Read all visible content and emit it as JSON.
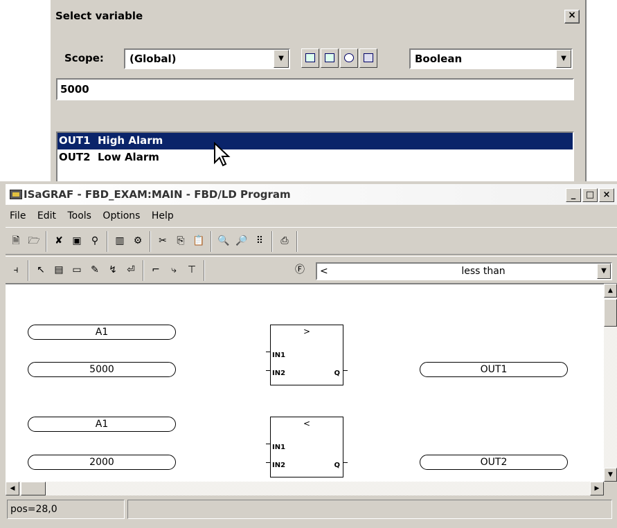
{
  "dialog": {
    "title": "Select variable",
    "close_label": "×",
    "scope_label": "Scope:",
    "scope_value": "(Global)",
    "type_value": "Boolean",
    "search_value": "5000",
    "variables": [
      {
        "name": "OUT1",
        "comment": "High Alarm",
        "selected": true
      },
      {
        "name": "OUT2",
        "comment": "Low Alarm",
        "selected": false
      }
    ]
  },
  "window": {
    "title": "ISaGRAF - FBD_EXAM:MAIN - FBD/LD Program",
    "minimize": "_",
    "maximize": "□",
    "close": "×"
  },
  "menu": [
    "File",
    "Edit",
    "Tools",
    "Options",
    "Help"
  ],
  "function_combo": {
    "symbol": "<",
    "label": "less than"
  },
  "diagram": {
    "row1": {
      "in_a": "A1",
      "in_b": "5000",
      "op": ">",
      "out": "OUT1"
    },
    "row2": {
      "in_a": "A1",
      "in_b": "2000",
      "op": "<",
      "out": "OUT2"
    },
    "pins": {
      "in1": "IN1",
      "in2": "IN2",
      "q": "Q"
    }
  },
  "status": {
    "position": "pos=28,0"
  },
  "colors": {
    "selection": "#0a246a",
    "face": "#d4d0c8"
  }
}
